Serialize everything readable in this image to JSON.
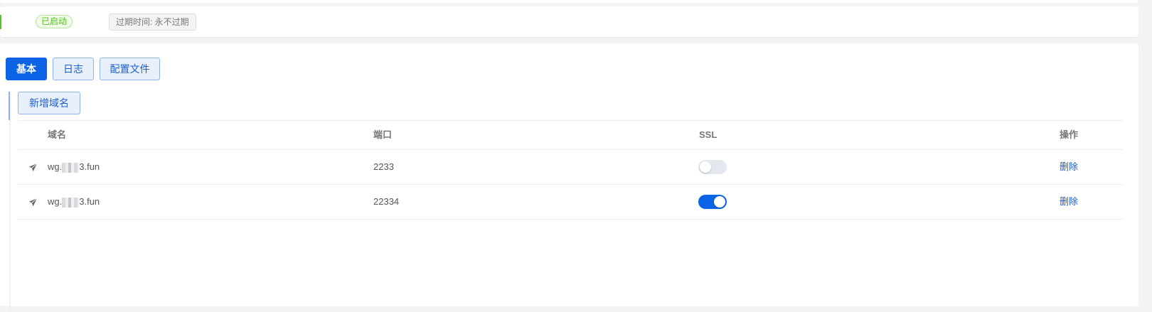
{
  "status": {
    "state_label": "已启动",
    "expire_label": "过期时间: 永不过期"
  },
  "tabs": [
    {
      "label": "基本",
      "active": true
    },
    {
      "label": "日志",
      "active": false
    },
    {
      "label": "配置文件",
      "active": false
    }
  ],
  "add_domain_label": "新增域名",
  "table": {
    "headers": {
      "domain": "域名",
      "port": "端口",
      "ssl": "SSL",
      "action": "操作"
    },
    "rows": [
      {
        "domain_prefix": "wg.",
        "domain_suffix": "3.fun",
        "port": "2233",
        "ssl": false,
        "action": "删除",
        "icon": "send-icon"
      },
      {
        "domain_prefix": "wg.",
        "domain_suffix": "3.fun",
        "port": "22334",
        "ssl": true,
        "action": "删除",
        "icon": "send-icon"
      }
    ]
  },
  "colors": {
    "primary": "#0b63e5",
    "success": "#52c41a",
    "switch_off": "#e4e7ed"
  }
}
